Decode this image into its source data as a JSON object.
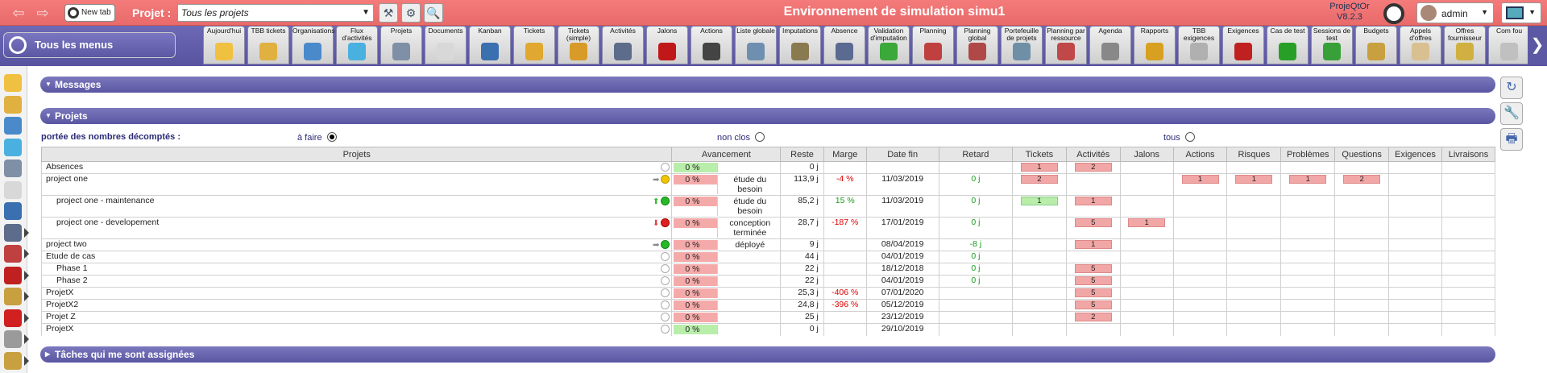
{
  "topbar": {
    "new_tab": "New tab",
    "project_label": "Projet :",
    "project_select": "Tous les projets",
    "env_title": "Environnement de simulation simu1",
    "app_name": "ProjeQtOr",
    "app_version": "V8.2.3",
    "user": "admin"
  },
  "menu": {
    "all_menus": "Tous les menus",
    "items": [
      {
        "label": "Aujourd'hui",
        "icon": "today-icon",
        "color": "#f0c040"
      },
      {
        "label": "TBB tickets",
        "icon": "tickets-dashboard-icon",
        "color": "#e0b040"
      },
      {
        "label": "Organisations",
        "icon": "organisations-icon",
        "color": "#4a8acb"
      },
      {
        "label": "Flux d'activités",
        "icon": "activity-stream-icon",
        "color": "#4ab0e0"
      },
      {
        "label": "Projets",
        "icon": "projects-icon",
        "color": "#7f8fa6"
      },
      {
        "label": "Documents",
        "icon": "documents-icon",
        "color": "#d8d8d8"
      },
      {
        "label": "Kanban",
        "icon": "kanban-icon",
        "color": "#3a6fb0"
      },
      {
        "label": "Tickets",
        "icon": "ticket-icon",
        "color": "#e0a830"
      },
      {
        "label": "Tickets (simple)",
        "icon": "ticket-simple-icon",
        "color": "#d89a28"
      },
      {
        "label": "Activités",
        "icon": "activities-icon",
        "color": "#5d6c8a"
      },
      {
        "label": "Jalons",
        "icon": "milestone-icon",
        "color": "#c01818"
      },
      {
        "label": "Actions",
        "icon": "actions-icon",
        "color": "#444444"
      },
      {
        "label": "Liste globale",
        "icon": "global-list-icon",
        "color": "#6f8fb0"
      },
      {
        "label": "Imputations",
        "icon": "imputation-icon",
        "color": "#8a7a50"
      },
      {
        "label": "Absence",
        "icon": "absence-icon",
        "color": "#5a6a90"
      },
      {
        "label": "Validation d'imputation",
        "icon": "validation-icon",
        "color": "#3aa83a"
      },
      {
        "label": "Planning",
        "icon": "planning-icon",
        "color": "#c04040"
      },
      {
        "label": "Planning global",
        "icon": "global-planning-icon",
        "color": "#b04848"
      },
      {
        "label": "Portefeuille de projets",
        "icon": "portfolio-icon",
        "color": "#6f8fa6"
      },
      {
        "label": "Planning par ressource",
        "icon": "resource-planning-icon",
        "color": "#c04848"
      },
      {
        "label": "Agenda",
        "icon": "agenda-icon",
        "color": "#888888"
      },
      {
        "label": "Rapports",
        "icon": "reports-icon",
        "color": "#d8a020"
      },
      {
        "label": "TBB exigences",
        "icon": "requirements-dashboard-icon",
        "color": "#b0b0b0"
      },
      {
        "label": "Exigences",
        "icon": "requirements-icon",
        "color": "#c02020"
      },
      {
        "label": "Cas de test",
        "icon": "test-case-icon",
        "color": "#28a028"
      },
      {
        "label": "Sessions de test",
        "icon": "test-session-icon",
        "color": "#38a038"
      },
      {
        "label": "Budgets",
        "icon": "budget-icon",
        "color": "#c8a040"
      },
      {
        "label": "Appels d'offres",
        "icon": "tenders-icon",
        "color": "#d8c090"
      },
      {
        "label": "Offres fournisseur",
        "icon": "supplier-offers-icon",
        "color": "#d0b040"
      },
      {
        "label": "Com fou",
        "icon": "supplier-orders-icon",
        "color": "#c0c0c0"
      }
    ]
  },
  "sidebar": [
    {
      "icon": "today-icon",
      "color": "#f0c040"
    },
    {
      "icon": "tickets-dashboard-icon",
      "color": "#e0b040"
    },
    {
      "icon": "organisations-icon",
      "color": "#4a8acb"
    },
    {
      "icon": "activity-stream-icon",
      "color": "#4ab0e0"
    },
    {
      "icon": "projects-icon",
      "color": "#7f8fa6"
    },
    {
      "icon": "documents-icon",
      "color": "#d8d8d8"
    },
    {
      "icon": "kanban-icon",
      "color": "#3a6fb0"
    },
    {
      "icon": "activities-icon",
      "color": "#5d6c8a"
    },
    {
      "icon": "planning-icon",
      "color": "#c04040"
    },
    {
      "icon": "requirements-icon",
      "color": "#c02020"
    },
    {
      "icon": "budget-icon",
      "color": "#c8a040"
    },
    {
      "icon": "risk-icon",
      "color": "#d02020"
    },
    {
      "icon": "tickets-icon",
      "color": "#9a9a9a"
    },
    {
      "icon": "box-icon",
      "color": "#c8a040"
    }
  ],
  "sections": {
    "messages": "Messages",
    "projects": "Projets",
    "tasks": "Tâches qui me sont assignées"
  },
  "scope": {
    "label": "portée des nombres décomptés :",
    "options": [
      {
        "label": "à faire",
        "checked": true
      },
      {
        "label": "non clos",
        "checked": false
      },
      {
        "label": "tous",
        "checked": false
      }
    ]
  },
  "columns": [
    "Projets",
    "Avancement",
    "Reste",
    "Marge",
    "Date fin",
    "Retard",
    "Tickets",
    "Activités",
    "Jalons",
    "Actions",
    "Risques",
    "Problèmes",
    "Questions",
    "Exigences",
    "Livraisons"
  ],
  "rows": [
    {
      "name": "Absences",
      "level": 1,
      "trend": "",
      "health": "none",
      "progress": "0 %",
      "progress_color": "green",
      "status": "",
      "reste": "0 j",
      "marge": "",
      "date_fin": "",
      "retard": "",
      "tickets": "1",
      "activites": "2",
      "jalons": "",
      "actions": "",
      "risques": "",
      "problemes": "",
      "questions": "",
      "exigences": "",
      "livraisons": ""
    },
    {
      "name": "project one",
      "level": 1,
      "trend": "flat",
      "health": "y",
      "progress": "0 %",
      "progress_color": "red",
      "status": "étude du besoin",
      "reste": "113,9 j",
      "marge": "-4 %",
      "date_fin": "11/03/2019",
      "retard": "0 j",
      "tickets": "2",
      "activites": "",
      "jalons": "",
      "actions": "1",
      "risques": "1",
      "problemes": "1",
      "questions": "2",
      "exigences": "",
      "livraisons": ""
    },
    {
      "name": "project one - maintenance",
      "level": 2,
      "trend": "up",
      "health": "g",
      "progress": "0 %",
      "progress_color": "red",
      "status": "étude du besoin",
      "reste": "85,2 j",
      "marge": "15 %",
      "date_fin": "11/03/2019",
      "retard": "0 j",
      "tickets": "1",
      "tickets_green": true,
      "activites": "1",
      "jalons": "",
      "actions": "",
      "risques": "",
      "problemes": "",
      "questions": "",
      "exigences": "",
      "livraisons": ""
    },
    {
      "name": "project one - developement",
      "level": 2,
      "trend": "dn",
      "health": "r",
      "progress": "0 %",
      "progress_color": "red",
      "status": "conception terminée",
      "reste": "28,7 j",
      "marge": "-187 %",
      "date_fin": "17/01/2019",
      "retard": "0 j",
      "tickets": "",
      "activites": "5",
      "jalons": "1",
      "actions": "",
      "risques": "",
      "problemes": "",
      "questions": "",
      "exigences": "",
      "livraisons": ""
    },
    {
      "name": "project two",
      "level": 1,
      "trend": "flat",
      "health": "g",
      "progress": "0 %",
      "progress_color": "red",
      "status": "déployé",
      "reste": "9 j",
      "marge": "",
      "date_fin": "08/04/2019",
      "retard": "-8 j",
      "tickets": "",
      "activites": "1",
      "jalons": "",
      "actions": "",
      "risques": "",
      "problemes": "",
      "questions": "",
      "exigences": "",
      "livraisons": ""
    },
    {
      "name": "Etude de cas",
      "level": 1,
      "trend": "",
      "health": "none",
      "progress": "0 %",
      "progress_color": "red",
      "status": "",
      "reste": "44 j",
      "marge": "",
      "date_fin": "04/01/2019",
      "retard": "0 j",
      "tickets": "",
      "activites": "",
      "jalons": "",
      "actions": "",
      "risques": "",
      "problemes": "",
      "questions": "",
      "exigences": "",
      "livraisons": ""
    },
    {
      "name": "Phase 1",
      "level": 2,
      "trend": "",
      "health": "none",
      "progress": "0 %",
      "progress_color": "red",
      "status": "",
      "reste": "22 j",
      "marge": "",
      "date_fin": "18/12/2018",
      "retard": "0 j",
      "tickets": "",
      "activites": "5",
      "jalons": "",
      "actions": "",
      "risques": "",
      "problemes": "",
      "questions": "",
      "exigences": "",
      "livraisons": ""
    },
    {
      "name": "Phase 2",
      "level": 2,
      "trend": "",
      "health": "none",
      "progress": "0 %",
      "progress_color": "red",
      "status": "",
      "reste": "22 j",
      "marge": "",
      "date_fin": "04/01/2019",
      "retard": "0 j",
      "tickets": "",
      "activites": "5",
      "jalons": "",
      "actions": "",
      "risques": "",
      "problemes": "",
      "questions": "",
      "exigences": "",
      "livraisons": ""
    },
    {
      "name": "ProjetX",
      "level": 1,
      "trend": "",
      "health": "none",
      "progress": "0 %",
      "progress_color": "red",
      "status": "",
      "reste": "25,3 j",
      "marge": "-406 %",
      "date_fin": "07/01/2020",
      "retard": "",
      "tickets": "",
      "activites": "5",
      "jalons": "",
      "actions": "",
      "risques": "",
      "problemes": "",
      "questions": "",
      "exigences": "",
      "livraisons": ""
    },
    {
      "name": "ProjetX2",
      "level": 1,
      "trend": "",
      "health": "none",
      "progress": "0 %",
      "progress_color": "red",
      "status": "",
      "reste": "24,8 j",
      "marge": "-396 %",
      "date_fin": "05/12/2019",
      "retard": "",
      "tickets": "",
      "activites": "5",
      "jalons": "",
      "actions": "",
      "risques": "",
      "problemes": "",
      "questions": "",
      "exigences": "",
      "livraisons": ""
    },
    {
      "name": "Projet Z",
      "level": 1,
      "trend": "",
      "health": "none",
      "progress": "0 %",
      "progress_color": "red",
      "status": "",
      "reste": "25 j",
      "marge": "",
      "date_fin": "23/12/2019",
      "retard": "",
      "tickets": "",
      "activites": "2",
      "jalons": "",
      "actions": "",
      "risques": "",
      "problemes": "",
      "questions": "",
      "exigences": "",
      "livraisons": ""
    },
    {
      "name": "ProjetX",
      "level": 1,
      "trend": "",
      "health": "none",
      "progress": "0 %",
      "progress_color": "green",
      "status": "",
      "reste": "0 j",
      "marge": "",
      "date_fin": "29/10/2019",
      "retard": "",
      "tickets": "",
      "activites": "",
      "jalons": "",
      "actions": "",
      "risques": "",
      "problemes": "",
      "questions": "",
      "exigences": "",
      "livraisons": ""
    }
  ]
}
